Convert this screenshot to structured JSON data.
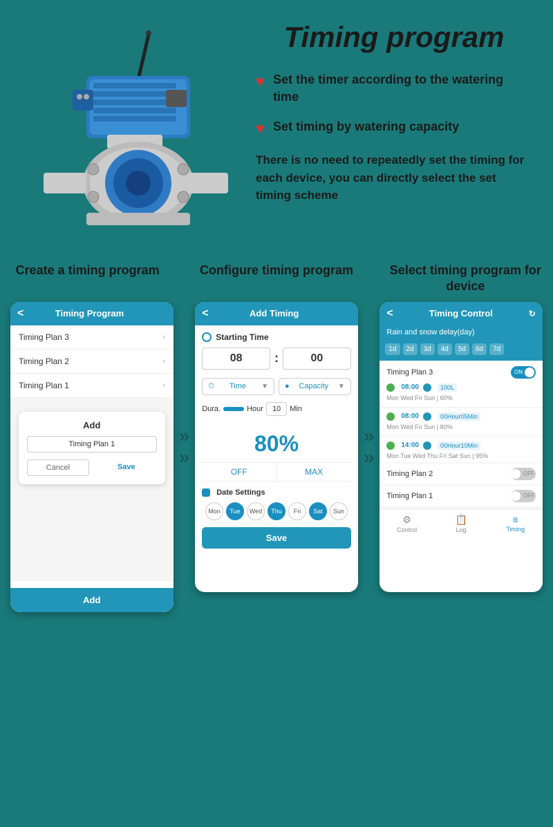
{
  "page": {
    "title": "Timing program",
    "background_color": "#1a7a7a"
  },
  "header": {
    "bullet1": "Set the timer according to the watering time",
    "bullet2": "Set timing by watering capacity",
    "description": "There is no need to repeatedly set the timing for each device, you can directly select the set timing scheme"
  },
  "phone1": {
    "label": "Create a timing program",
    "header_title": "Timing Program",
    "back_arrow": "<",
    "list_items": [
      "Timing Plan 3",
      "Timing Plan 2",
      "Timing Plan 1"
    ],
    "dialog_title": "Add",
    "dialog_input": "Timing Plan 1",
    "btn_cancel": "Cancel",
    "btn_save": "Save",
    "bottom_add": "Add"
  },
  "phone2": {
    "label": "Configure timing program",
    "header_title": "Add Timing",
    "back_arrow": "<",
    "starting_time_label": "Starting Time",
    "hour_val": "08",
    "minute_val": "00",
    "time_label": "Time",
    "capacity_label": "Capacity",
    "dura_label": "Dura.",
    "hour_unit": "Hour",
    "min_val": "10",
    "min_unit": "Min",
    "percent": "80%",
    "off_label": "OFF",
    "max_label": "MAX",
    "date_settings_label": "Date Settings",
    "days": [
      {
        "label": "Mon",
        "active": false
      },
      {
        "label": "Tue",
        "active": true
      },
      {
        "label": "Wed",
        "active": false
      },
      {
        "label": "Thu",
        "active": true
      },
      {
        "label": "Fri",
        "active": false
      },
      {
        "label": "Sat",
        "active": true
      },
      {
        "label": "Sun",
        "active": false
      }
    ],
    "save_label": "Save"
  },
  "phone3": {
    "label": "Select timing program for device",
    "header_title": "Timing Control",
    "back_arrow": "<",
    "rain_delay_label": "Rain and snow delay(day)",
    "day_buttons": [
      "1d",
      "2d",
      "3d",
      "4d",
      "5d",
      "6d",
      "7d"
    ],
    "plan3": {
      "title": "Timing Plan 3",
      "toggle": "ON",
      "schedules": [
        {
          "time": "08:00",
          "tag": "100L",
          "days": "Mon Wed Fri Sun | 60%"
        },
        {
          "time": "08:00",
          "tag": "00Hour05Min",
          "days": "Mon Wed Fri Sun | 80%"
        },
        {
          "time": "14:00",
          "tag": "00Hour10Min",
          "days": "Mon Tue Wed Thu Fri Sat Sun | 95%"
        }
      ]
    },
    "plan2": {
      "title": "Timing Plan 2",
      "toggle": "OFF"
    },
    "plan1": {
      "title": "Timing Plan 1",
      "toggle": "OFF"
    },
    "nav_control": "Control",
    "nav_log": "Log",
    "nav_timing": "Timing"
  },
  "dura_hou_text": "Dura Hou"
}
